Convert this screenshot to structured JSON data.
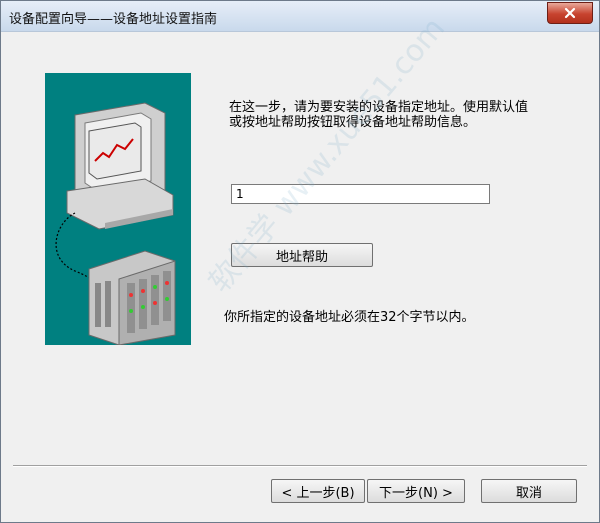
{
  "window": {
    "title": "设备配置向导——设备地址设置指南"
  },
  "content": {
    "instruction": "在这一步，请为要安装的设备指定地址。使用默认值或按地址帮助按钮取得设备地址帮助信息。",
    "address_value": "1",
    "help_button": "地址帮助",
    "limit_note": "你所指定的设备地址必须在32个字节以内。"
  },
  "footer": {
    "back_label": "< 上一步(B)",
    "next_label": "下一步(N) >",
    "cancel_label": "取消"
  },
  "watermark": "软件学 www.xue51.com",
  "colors": {
    "panel": "#008080",
    "close": "#c7432f"
  }
}
